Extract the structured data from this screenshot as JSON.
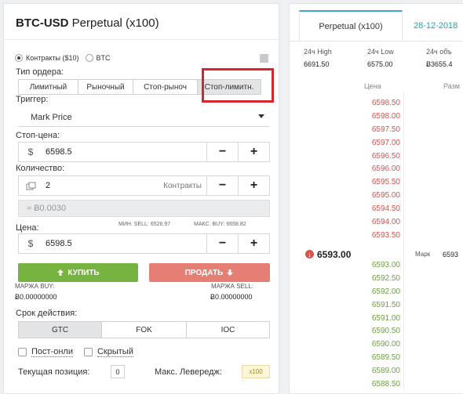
{
  "order_form": {
    "title_bold": "BTC-USD",
    "title_rest": "Perpetual (x100)",
    "units": [
      {
        "label": "Контракты ($10)",
        "selected": true
      },
      {
        "label": "BTC",
        "selected": false
      }
    ],
    "calculator_icon": "calculator-icon",
    "order_type_label": "Тип ордера:",
    "order_types": [
      {
        "label": "Лимитный",
        "active": false
      },
      {
        "label": "Рыночный",
        "active": false
      },
      {
        "label": "Стоп-рыноч",
        "active": false
      },
      {
        "label": "Стоп-лимитн.",
        "active": true
      }
    ],
    "trigger_label": "Триггер:",
    "trigger_value": "Mark Price",
    "stop_price_label": "Стоп-цена:",
    "stop_price_prefix": "$",
    "stop_price_value": "6598.5",
    "quantity_label": "Количество:",
    "quantity_value": "2",
    "quantity_unit": "Контракты",
    "btc_estimate": "≈ Ƀ0.0030",
    "price_label": "Цена:",
    "min_sell": "МИН. SELL: 6526.97",
    "max_buy": "МАКС. BUY: 6658.82",
    "price_prefix": "$",
    "price_value": "6598.5",
    "minus": "−",
    "plus": "+",
    "buy_label": "КУПИТЬ",
    "sell_label": "ПРОДАТЬ",
    "buy_margin_label": "МАРЖА BUY:",
    "buy_margin_value": "Ƀ0.00000000",
    "sell_margin_label": "МАРЖА SELL:",
    "sell_margin_value": "Ƀ0.00000000",
    "tif_label": "Срок действия:",
    "tif_options": [
      {
        "label": "GTC",
        "active": true
      },
      {
        "label": "FOK",
        "active": false
      },
      {
        "label": "IOC",
        "active": false
      }
    ],
    "post_only_label": "Пост-онли",
    "hidden_label": "Скрытый",
    "position_label": "Текущая позиция:",
    "position_value": "0",
    "leverage_label": "Макс. Левередж:",
    "leverage_value": "x100"
  },
  "order_book": {
    "tabs": [
      "Perpetual (x100)",
      "28-12-2018"
    ],
    "stats": [
      {
        "label": "24ч High",
        "value": "6691.50"
      },
      {
        "label": "24ч Low",
        "value": "6575.00"
      },
      {
        "label": "24ч объ",
        "value": "Ƀ3655.4"
      }
    ],
    "col_price": "Цена",
    "col_size": "Разм",
    "asks": [
      "6598.50",
      "6598.00",
      "6597.50",
      "6597.00",
      "6596.50",
      "6596.00",
      "6595.50",
      "6595.00",
      "6594.50",
      "6594.00",
      "6593.50"
    ],
    "last_price": "6593.00",
    "mark_label": "Марк",
    "mark_value": "6593",
    "bids": [
      "6593.00",
      "6592.50",
      "6592.00",
      "6591.50",
      "6591.00",
      "6590.50",
      "6590.00",
      "6589.50",
      "6589.00",
      "6588.50"
    ]
  },
  "colors": {
    "buy": "#77b43f",
    "sell": "#e57e73",
    "ask_text": "#d9534f",
    "bid_text": "#6da33d",
    "accent_tab": "#41a8c4",
    "highlight": "#d6262e"
  }
}
